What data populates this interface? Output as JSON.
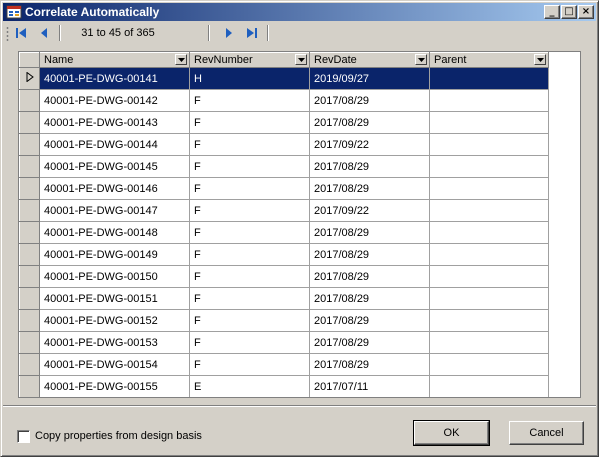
{
  "window": {
    "title": "Correlate Automatically",
    "controls": {
      "minimize": "_",
      "maximize": "□",
      "close": "×"
    }
  },
  "toolbar": {
    "position_text": "31 to 45 of 365",
    "icons": [
      "first-record-icon",
      "previous-record-icon",
      "next-record-icon",
      "last-record-icon"
    ]
  },
  "grid": {
    "columns": [
      {
        "label": "Name"
      },
      {
        "label": "RevNumber"
      },
      {
        "label": "RevDate"
      },
      {
        "label": "Parent"
      }
    ],
    "selected_row": 0,
    "rows": [
      {
        "name": "40001-PE-DWG-00141",
        "rev": "H",
        "date": "2019/09/27",
        "parent": ""
      },
      {
        "name": "40001-PE-DWG-00142",
        "rev": "F",
        "date": "2017/08/29",
        "parent": ""
      },
      {
        "name": "40001-PE-DWG-00143",
        "rev": "F",
        "date": "2017/08/29",
        "parent": ""
      },
      {
        "name": "40001-PE-DWG-00144",
        "rev": "F",
        "date": "2017/09/22",
        "parent": ""
      },
      {
        "name": "40001-PE-DWG-00145",
        "rev": "F",
        "date": "2017/08/29",
        "parent": ""
      },
      {
        "name": "40001-PE-DWG-00146",
        "rev": "F",
        "date": "2017/08/29",
        "parent": ""
      },
      {
        "name": "40001-PE-DWG-00147",
        "rev": "F",
        "date": "2017/09/22",
        "parent": ""
      },
      {
        "name": "40001-PE-DWG-00148",
        "rev": "F",
        "date": "2017/08/29",
        "parent": ""
      },
      {
        "name": "40001-PE-DWG-00149",
        "rev": "F",
        "date": "2017/08/29",
        "parent": ""
      },
      {
        "name": "40001-PE-DWG-00150",
        "rev": "F",
        "date": "2017/08/29",
        "parent": ""
      },
      {
        "name": "40001-PE-DWG-00151",
        "rev": "F",
        "date": "2017/08/29",
        "parent": ""
      },
      {
        "name": "40001-PE-DWG-00152",
        "rev": "F",
        "date": "2017/08/29",
        "parent": ""
      },
      {
        "name": "40001-PE-DWG-00153",
        "rev": "F",
        "date": "2017/08/29",
        "parent": ""
      },
      {
        "name": "40001-PE-DWG-00154",
        "rev": "F",
        "date": "2017/08/29",
        "parent": ""
      },
      {
        "name": "40001-PE-DWG-00155",
        "rev": "E",
        "date": "2017/07/11",
        "parent": ""
      }
    ]
  },
  "footer": {
    "checkbox_label": "Copy properties from design basis",
    "checkbox_checked": false,
    "ok_label": "OK",
    "cancel_label": "Cancel"
  },
  "colors": {
    "selection": "#0a246a",
    "nav_arrow": "#1f5fbf",
    "titlebar_start": "#0a246a",
    "titlebar_end": "#a6caf0"
  }
}
